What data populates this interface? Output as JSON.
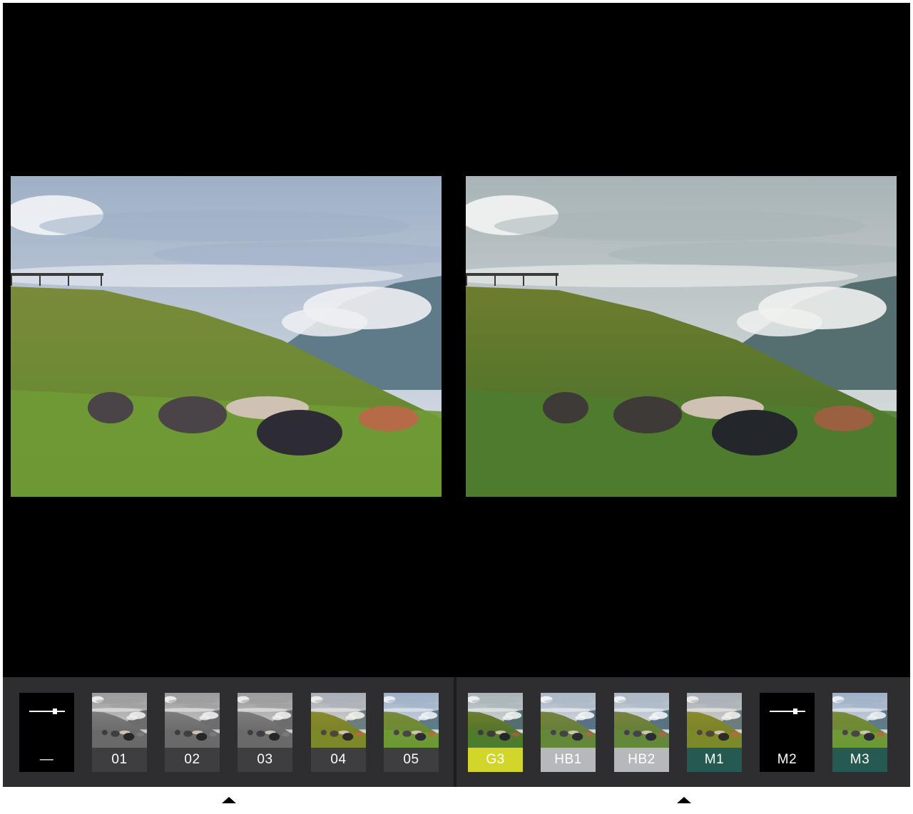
{
  "panels": [
    {
      "id": "left",
      "thumbs": [
        {
          "label": "—",
          "kind": "adjust",
          "label_bg": "#000000",
          "label_fg": "#ffffff"
        },
        {
          "label": "01",
          "kind": "preset",
          "tone": "mono",
          "label_bg": "#3e3e40",
          "label_fg": "#ffffff"
        },
        {
          "label": "02",
          "kind": "preset",
          "tone": "mono",
          "label_bg": "#3e3e40",
          "label_fg": "#ffffff"
        },
        {
          "label": "03",
          "kind": "preset",
          "tone": "mono",
          "label_bg": "#3e3e40",
          "label_fg": "#ffffff"
        },
        {
          "label": "04",
          "kind": "preset",
          "tone": "warm",
          "label_bg": "#3e3e40",
          "label_fg": "#ffffff"
        },
        {
          "label": "05",
          "kind": "preset",
          "tone": "natural",
          "label_bg": "#3e3e40",
          "label_fg": "#ffffff"
        }
      ]
    },
    {
      "id": "right",
      "thumbs": [
        {
          "label": "G3",
          "kind": "preset",
          "tone": "green",
          "label_bg": "#d3d62a",
          "label_fg": "#ffffff"
        },
        {
          "label": "HB1",
          "kind": "preset",
          "tone": "cool",
          "label_bg": "#b7b8bc",
          "label_fg": "#ffffff"
        },
        {
          "label": "HB2",
          "kind": "preset",
          "tone": "cool",
          "label_bg": "#b7b8bc",
          "label_fg": "#ffffff"
        },
        {
          "label": "M1",
          "kind": "preset",
          "tone": "warm",
          "label_bg": "#245a52",
          "label_fg": "#ffffff"
        },
        {
          "label": "M2",
          "kind": "adjust",
          "label_bg": "#000000",
          "label_fg": "#ffffff"
        },
        {
          "label": "M3",
          "kind": "preset",
          "tone": "natural",
          "label_bg": "#245a52",
          "label_fg": "#ffffff"
        }
      ]
    }
  ],
  "colors": {
    "stage": "#000000",
    "strip": "#2e2e30",
    "caret": "#000000"
  },
  "icons": {
    "adjust": "slider-icon",
    "selection": "caret-up-icon"
  }
}
